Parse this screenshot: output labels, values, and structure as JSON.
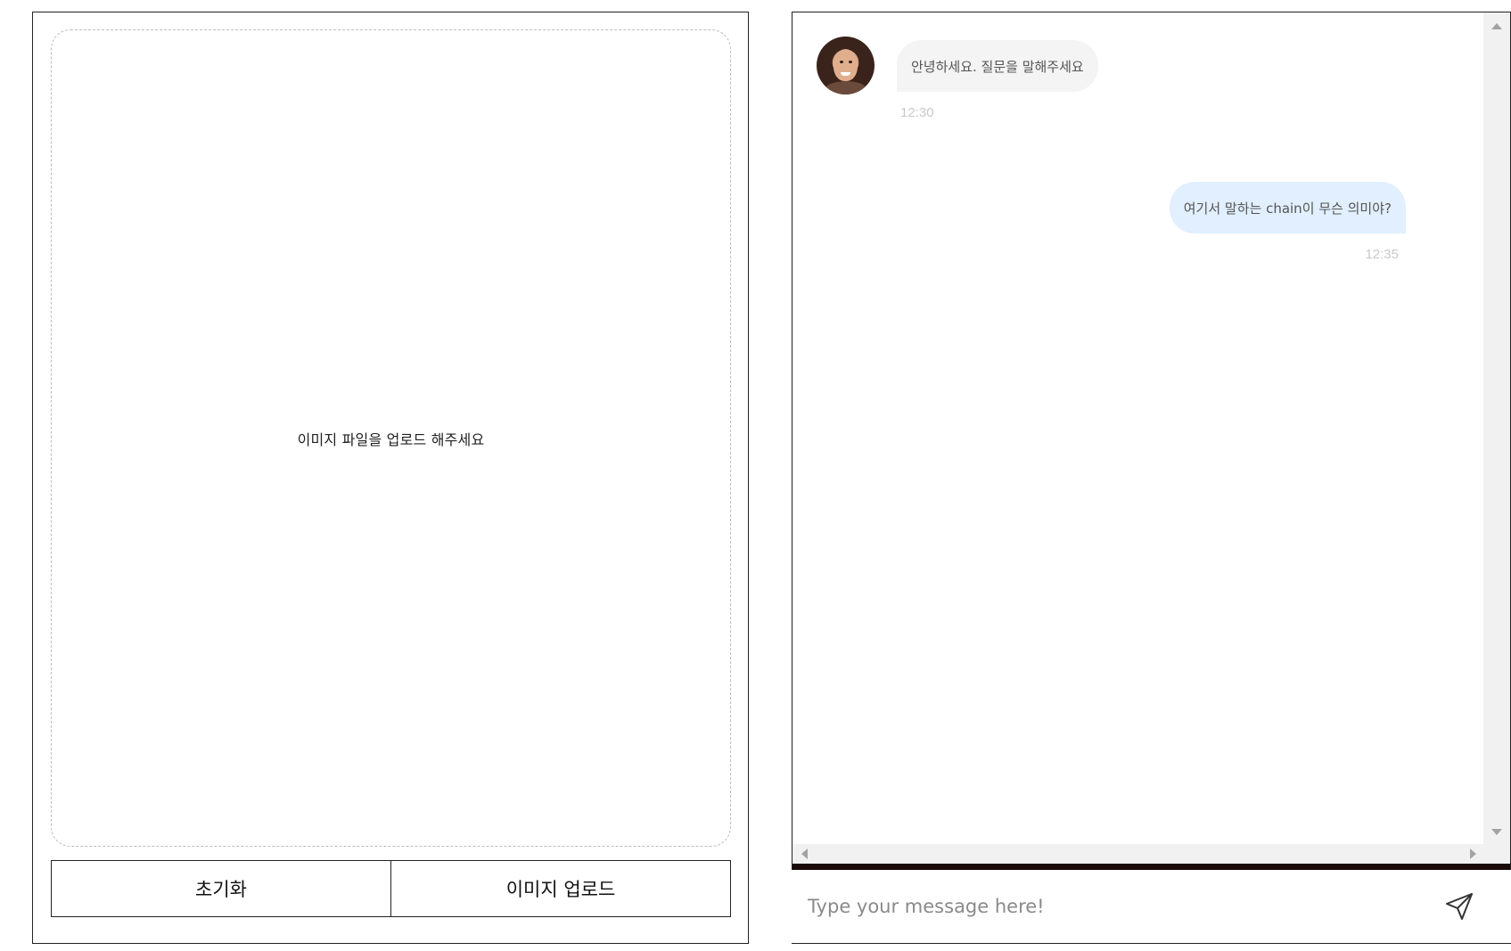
{
  "upload_panel": {
    "dropzone_text": "이미지 파일을 업로드 해주세요",
    "reset_label": "초기화",
    "upload_label": "이미지 업로드"
  },
  "chat": {
    "messages": [
      {
        "direction": "incoming",
        "text": "안녕하세요. 질문을 말해주세요",
        "time": "12:30"
      },
      {
        "direction": "outgoing",
        "text": "여기서 말하는 chain이 무슨 의미야?",
        "time": "12:35"
      }
    ],
    "input": {
      "placeholder": "Type your message here!",
      "value": ""
    }
  },
  "icons": {
    "send": "send-icon",
    "avatar": "avatar-photo"
  },
  "colors": {
    "incoming_bubble": "#f4f4f4",
    "outgoing_bubble": "#e1efff",
    "timestamp": "#c9c9c9",
    "divider": "#1a0a0a"
  }
}
